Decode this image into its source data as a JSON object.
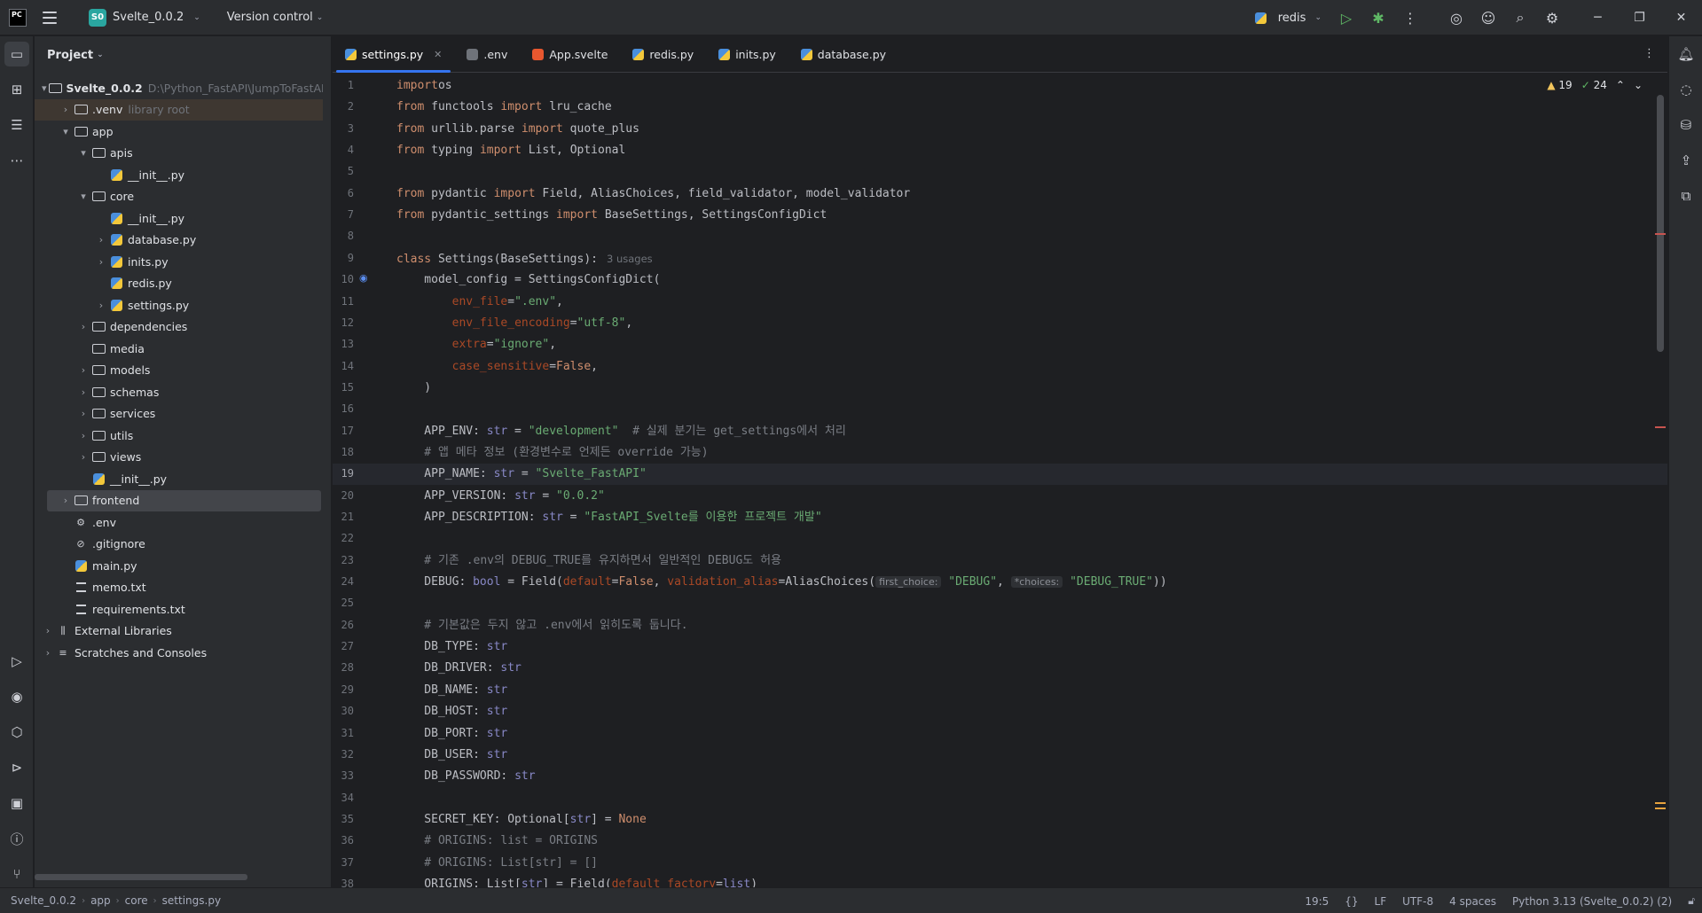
{
  "titlebar": {
    "logo": "PC",
    "project_badge": "S0",
    "project_name": "Svelte_0.0.2",
    "version_control": "Version control",
    "run_config": "redis",
    "menu_icon": "hamburger-icon"
  },
  "project_panel": {
    "title": "Project",
    "tree": [
      {
        "label": "Svelte_0.0.2",
        "extra": "D:\\Python_FastAPI\\JumpToFastAPI_Sv",
        "type": "folder",
        "level": 0,
        "arrow": "▾",
        "bold": true
      },
      {
        "label": ".venv",
        "extra": "library root",
        "type": "folder",
        "level": 1,
        "arrow": "›",
        "highlight": true
      },
      {
        "label": "app",
        "extra": "",
        "type": "folder",
        "level": 1,
        "arrow": "▾"
      },
      {
        "label": "apis",
        "extra": "",
        "type": "folder",
        "level": 2,
        "arrow": "▾"
      },
      {
        "label": "__init__.py",
        "extra": "",
        "type": "py",
        "level": 3,
        "arrow": ""
      },
      {
        "label": "core",
        "extra": "",
        "type": "folder",
        "level": 2,
        "arrow": "▾"
      },
      {
        "label": "__init__.py",
        "extra": "",
        "type": "py",
        "level": 3,
        "arrow": ""
      },
      {
        "label": "database.py",
        "extra": "",
        "type": "py",
        "level": 3,
        "arrow": "›"
      },
      {
        "label": "inits.py",
        "extra": "",
        "type": "py",
        "level": 3,
        "arrow": "›"
      },
      {
        "label": "redis.py",
        "extra": "",
        "type": "py",
        "level": 3,
        "arrow": ""
      },
      {
        "label": "settings.py",
        "extra": "",
        "type": "py",
        "level": 3,
        "arrow": "›"
      },
      {
        "label": "dependencies",
        "extra": "",
        "type": "folder",
        "level": 2,
        "arrow": "›"
      },
      {
        "label": "media",
        "extra": "",
        "type": "folder",
        "level": 2,
        "arrow": ""
      },
      {
        "label": "models",
        "extra": "",
        "type": "folder",
        "level": 2,
        "arrow": "›"
      },
      {
        "label": "schemas",
        "extra": "",
        "type": "folder",
        "level": 2,
        "arrow": "›"
      },
      {
        "label": "services",
        "extra": "",
        "type": "folder",
        "level": 2,
        "arrow": "›"
      },
      {
        "label": "utils",
        "extra": "",
        "type": "folder",
        "level": 2,
        "arrow": "›"
      },
      {
        "label": "views",
        "extra": "",
        "type": "folder",
        "level": 2,
        "arrow": "›"
      },
      {
        "label": "__init__.py",
        "extra": "",
        "type": "py",
        "level": 2,
        "arrow": ""
      },
      {
        "label": "frontend",
        "extra": "",
        "type": "folder",
        "level": 1,
        "arrow": "›",
        "selected": true
      },
      {
        "label": ".env",
        "extra": "",
        "type": "env",
        "level": 1,
        "arrow": ""
      },
      {
        "label": ".gitignore",
        "extra": "",
        "type": "ignore",
        "level": 1,
        "arrow": ""
      },
      {
        "label": "main.py",
        "extra": "",
        "type": "py",
        "level": 1,
        "arrow": ""
      },
      {
        "label": "memo.txt",
        "extra": "",
        "type": "txt",
        "level": 1,
        "arrow": ""
      },
      {
        "label": "requirements.txt",
        "extra": "",
        "type": "txt",
        "level": 1,
        "arrow": ""
      },
      {
        "label": "External Libraries",
        "extra": "",
        "type": "lib",
        "level": 0,
        "arrow": "›"
      },
      {
        "label": "Scratches and Consoles",
        "extra": "",
        "type": "scratch",
        "level": 0,
        "arrow": "›"
      }
    ]
  },
  "tabs": [
    {
      "label": "settings.py",
      "icon": "python-file-icon",
      "active": true,
      "closable": true
    },
    {
      "label": ".env",
      "icon": "env-file-icon"
    },
    {
      "label": "App.svelte",
      "icon": "svelte-file-icon"
    },
    {
      "label": "redis.py",
      "icon": "python-file-icon"
    },
    {
      "label": "inits.py",
      "icon": "python-file-icon"
    },
    {
      "label": "database.py",
      "icon": "python-file-icon"
    }
  ],
  "editor": {
    "warnings": "19",
    "weak_warnings": "24",
    "current_line": 19,
    "lines": [
      [
        [
          "kw",
          "import"
        ],
        [
          "",
          "os"
        ]
      ],
      [
        [
          "kw",
          "from"
        ],
        [
          "",
          " functools "
        ],
        [
          "kw",
          "import"
        ],
        [
          "",
          " lru_cache"
        ]
      ],
      [
        [
          "kw",
          "from"
        ],
        [
          "",
          " urllib.parse "
        ],
        [
          "kw",
          "import"
        ],
        [
          "",
          " quote_plus"
        ]
      ],
      [
        [
          "kw",
          "from"
        ],
        [
          "",
          " typing "
        ],
        [
          "kw",
          "import"
        ],
        [
          "",
          " List, Optional"
        ]
      ],
      [],
      [
        [
          "kw",
          "from"
        ],
        [
          "",
          " pydantic "
        ],
        [
          "kw",
          "import"
        ],
        [
          "",
          " Field, AliasChoices, field_validator, model_validator"
        ]
      ],
      [
        [
          "kw",
          "from"
        ],
        [
          "",
          " pydantic_settings "
        ],
        [
          "kw",
          "import"
        ],
        [
          "",
          " BaseSettings, SettingsConfigDict"
        ]
      ],
      [],
      [
        [
          "kw",
          "class"
        ],
        [
          "",
          " Settings(BaseSettings):"
        ],
        [
          "usages",
          "3 usages"
        ]
      ],
      [
        [
          "",
          "    model_config = SettingsConfigDict("
        ]
      ],
      [
        [
          "",
          "        "
        ],
        [
          "kwarg",
          "env_file"
        ],
        [
          "",
          "="
        ],
        [
          "str",
          "\".env\""
        ],
        [
          "",
          ","
        ]
      ],
      [
        [
          "",
          "        "
        ],
        [
          "kwarg",
          "env_file_encoding"
        ],
        [
          "",
          "="
        ],
        [
          "str",
          "\"utf-8\""
        ],
        [
          "",
          ","
        ]
      ],
      [
        [
          "",
          "        "
        ],
        [
          "kwarg",
          "extra"
        ],
        [
          "",
          "="
        ],
        [
          "str",
          "\"ignore\""
        ],
        [
          "",
          ","
        ]
      ],
      [
        [
          "",
          "        "
        ],
        [
          "kwarg",
          "case_sensitive"
        ],
        [
          "",
          "="
        ],
        [
          "kw",
          "False"
        ],
        [
          "",
          ","
        ]
      ],
      [
        [
          "",
          "    )"
        ]
      ],
      [],
      [
        [
          "",
          "    APP_ENV: "
        ],
        [
          "builtin",
          "str"
        ],
        [
          "",
          " = "
        ],
        [
          "str",
          "\"development\""
        ],
        [
          "cm",
          "  # 실제 분기는 get_settings에서 처리"
        ]
      ],
      [
        [
          "cm",
          "    # 앱 메타 정보 (환경변수로 언제든 override 가능)"
        ]
      ],
      [
        [
          "",
          "    APP_NAME: "
        ],
        [
          "builtin",
          "str"
        ],
        [
          "",
          " = "
        ],
        [
          "str",
          "\"Svelte_FastAPI\""
        ]
      ],
      [
        [
          "",
          "    APP_VERSION: "
        ],
        [
          "builtin",
          "str"
        ],
        [
          "",
          " = "
        ],
        [
          "str",
          "\"0.0.2\""
        ]
      ],
      [
        [
          "",
          "    APP_DESCRIPTION: "
        ],
        [
          "builtin",
          "str"
        ],
        [
          "",
          " = "
        ],
        [
          "str",
          "\"FastAPI_Svelte를 이용한 프로젝트 개발\""
        ]
      ],
      [],
      [
        [
          "cm",
          "    # 기존 .env의 DEBUG_TRUE를 유지하면서 일반적인 DEBUG도 허용"
        ]
      ],
      [
        [
          "",
          "    DEBUG: "
        ],
        [
          "builtin",
          "bool"
        ],
        [
          "",
          " = Field("
        ],
        [
          "kwarg",
          "default"
        ],
        [
          "",
          "="
        ],
        [
          "kw",
          "False"
        ],
        [
          "",
          ", "
        ],
        [
          "kwarg",
          "validation_alias"
        ],
        [
          "",
          "=AliasChoices("
        ],
        [
          "hint",
          "first_choice:"
        ],
        [
          "",
          " "
        ],
        [
          "str",
          "\"DEBUG\""
        ],
        [
          "",
          ", "
        ],
        [
          "hint",
          "*choices:"
        ],
        [
          "",
          " "
        ],
        [
          "str",
          "\"DEBUG_TRUE\""
        ],
        [
          "",
          "))"
        ]
      ],
      [],
      [
        [
          "cm",
          "    # 기본값은 두지 않고 .env에서 읽히도록 둡니다."
        ]
      ],
      [
        [
          "",
          "    DB_TYPE: "
        ],
        [
          "builtin",
          "str"
        ]
      ],
      [
        [
          "",
          "    DB_DRIVER: "
        ],
        [
          "builtin",
          "str"
        ]
      ],
      [
        [
          "",
          "    DB_NAME: "
        ],
        [
          "builtin",
          "str"
        ]
      ],
      [
        [
          "",
          "    DB_HOST: "
        ],
        [
          "builtin",
          "str"
        ]
      ],
      [
        [
          "",
          "    DB_PORT: "
        ],
        [
          "builtin",
          "str"
        ]
      ],
      [
        [
          "",
          "    DB_USER: "
        ],
        [
          "builtin",
          "str"
        ]
      ],
      [
        [
          "",
          "    DB_PASSWORD: "
        ],
        [
          "builtin",
          "str"
        ]
      ],
      [],
      [
        [
          "",
          "    SECRET_KEY: Optional["
        ],
        [
          "builtin",
          "str"
        ],
        [
          "",
          "] = "
        ],
        [
          "kw",
          "None"
        ]
      ],
      [
        [
          "cm",
          "    # ORIGINS: list = ORIGINS"
        ]
      ],
      [
        [
          "cm",
          "    # ORIGINS: List[str] = []"
        ]
      ],
      [
        [
          "",
          "    ORIGINS: List["
        ],
        [
          "builtin",
          "str"
        ],
        [
          "",
          "] = Field("
        ],
        [
          "kwarg",
          "default_factory"
        ],
        [
          "",
          "="
        ],
        [
          "builtin",
          "list"
        ],
        [
          "",
          ")"
        ]
      ]
    ]
  },
  "statusbar": {
    "breadcrumb": [
      "Svelte_0.0.2",
      "app",
      "core",
      "settings.py"
    ],
    "position": "19:5",
    "line_ending": "LF",
    "encoding": "UTF-8",
    "indent": "4 spaces",
    "interpreter": "Python 3.13 (Svelte_0.0.2) (2)"
  },
  "colors": {
    "accent": "#3574f0",
    "keyword": "#cf8e6d",
    "string": "#6aab73",
    "comment": "#7a7e85",
    "kwarg": "#aa4926"
  }
}
